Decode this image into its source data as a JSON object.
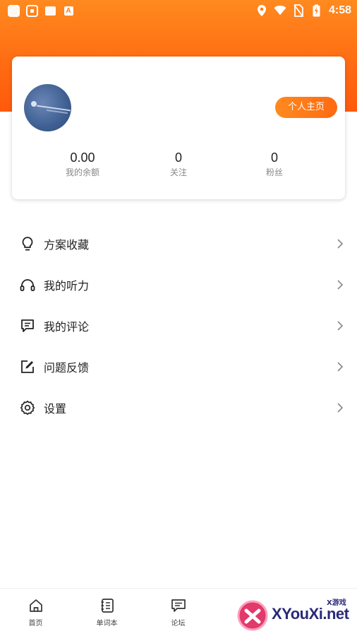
{
  "status_bar": {
    "time": "4:58",
    "left_icons": [
      "app-icon",
      "notification-icon",
      "image-icon",
      "font-icon"
    ],
    "right_icons": [
      "location-icon",
      "wifi-icon",
      "no-sim-icon",
      "battery-charging-icon"
    ]
  },
  "profile": {
    "homepage_button": "个人主页",
    "stats": [
      {
        "value": "0.00",
        "label": "我的余额"
      },
      {
        "value": "0",
        "label": "关注"
      },
      {
        "value": "0",
        "label": "粉丝"
      }
    ]
  },
  "menu": [
    {
      "label": "方案收藏",
      "icon": "lightbulb-icon"
    },
    {
      "label": "我的听力",
      "icon": "headphones-icon"
    },
    {
      "label": "我的评论",
      "icon": "comment-icon"
    },
    {
      "label": "问题反馈",
      "icon": "edit-icon"
    },
    {
      "label": "设置",
      "icon": "gear-icon"
    }
  ],
  "bottom_nav": [
    {
      "label": "首页",
      "icon": "home-icon"
    },
    {
      "label": "单词本",
      "icon": "notebook-icon"
    },
    {
      "label": "论坛",
      "icon": "forum-icon"
    }
  ],
  "watermark": {
    "text": "XYouXi.net",
    "small": "X游戏"
  },
  "colors": {
    "accent": "#ff6a12",
    "accent_light": "#ff8a1f"
  }
}
